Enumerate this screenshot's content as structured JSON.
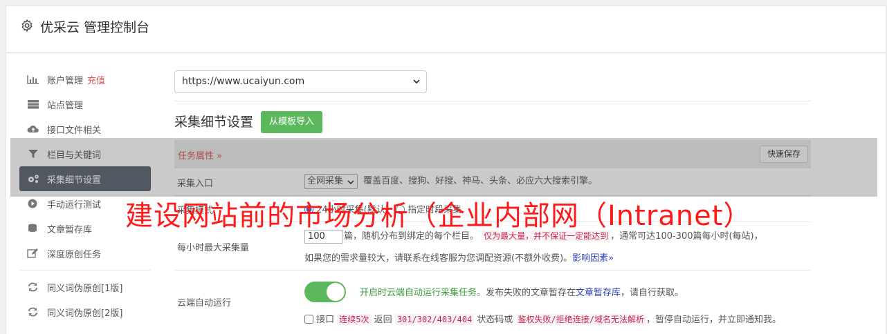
{
  "header": {
    "title": "优采云 管理控制台"
  },
  "sidebar": {
    "items": [
      {
        "label": "账户管理",
        "extra": "充值",
        "icon": "bar-chart-icon"
      },
      {
        "label": "站点管理",
        "icon": "server-icon"
      },
      {
        "label": "接口文件相关",
        "icon": "cloud-upload-icon"
      },
      {
        "label": "栏目与关键词",
        "icon": "filter-icon"
      },
      {
        "label": "采集细节设置",
        "icon": "gears-icon",
        "active": true
      },
      {
        "label": "手动运行测试",
        "icon": "play-icon"
      },
      {
        "label": "文章暂存库",
        "icon": "database-icon"
      },
      {
        "label": "深度原创任务",
        "icon": "edit-icon"
      }
    ],
    "items2": [
      {
        "label": "同义词伪原创[1版]",
        "icon": "refresh-icon"
      },
      {
        "label": "同义词伪原创[2版]",
        "icon": "refresh-icon"
      }
    ]
  },
  "main": {
    "site_select": "https://www.ucaiyun.com",
    "section_title": "采集细节设置",
    "import_button": "从模板导入",
    "task_attr": "任务属性 »",
    "quick_save": "快速保存",
    "collect_entry": {
      "label": "采集入口",
      "select": "全网采集",
      "desc": "覆盖百度、搜狗、好搜、神马、头条、必应六大搜索引擎。"
    },
    "collect_mode": {
      "label": "采集模式",
      "opt1": "24小时采集(默认)",
      "opt2": "指定时段采集"
    },
    "max_per_hour": {
      "label": "每小时最大采集量",
      "value": "100",
      "text1": "篇，随机分布到绑定的每个栏目。",
      "warn": "仅为最大量，并不保证一定能达到",
      "text2": "，通常可达100-300篇每小时(每站)，",
      "text3": "如果您的需求量较大，请联系在线客服为您调配资源(不额外收费)。",
      "link": "影响因素»"
    },
    "cloud_run": {
      "label": "云端自动运行",
      "green_text": "开启时云端自动运行采集任务。",
      "text1": "发布失败的文章暂存在",
      "link": "文章暂存库",
      "text2": "，请自行获取。",
      "cb_text": "接口",
      "pink1": "连续5次",
      "text3": "返回",
      "pink2": "301/302/403/404",
      "text4": "状态码或",
      "pink3": "鉴权失败/拒绝连接/域名无法解析",
      "text5": "，暂停自动运行，并立即通知我。"
    }
  },
  "overlay_title": "建设网站前的市场分析（企业内部网（Intranet）"
}
